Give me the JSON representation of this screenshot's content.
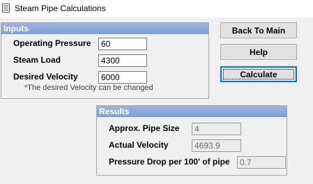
{
  "window": {
    "title": "Steam Pipe Calculations"
  },
  "inputs": {
    "header": "Inputs",
    "operating_pressure": {
      "label": "Operating Pressure",
      "value": "60"
    },
    "steam_load": {
      "label": "Steam Load",
      "value": "4300"
    },
    "desired_velocity": {
      "label": "Desired Velocity",
      "value": "6000"
    },
    "note": "*The desired Velocity can be changed"
  },
  "buttons": {
    "back_to_main": "Back To Main",
    "help": "Help",
    "calculate": "Calculate"
  },
  "results": {
    "header": "Results",
    "pipe_size": {
      "label": "Approx. Pipe Size",
      "value": "4"
    },
    "actual_velocity": {
      "label": "Actual Velocity",
      "value": "4693.9"
    },
    "pressure_drop": {
      "label": "Pressure Drop per 100' of pipe",
      "value": "0.7"
    }
  },
  "icons": {
    "app": "app-window-icon"
  }
}
